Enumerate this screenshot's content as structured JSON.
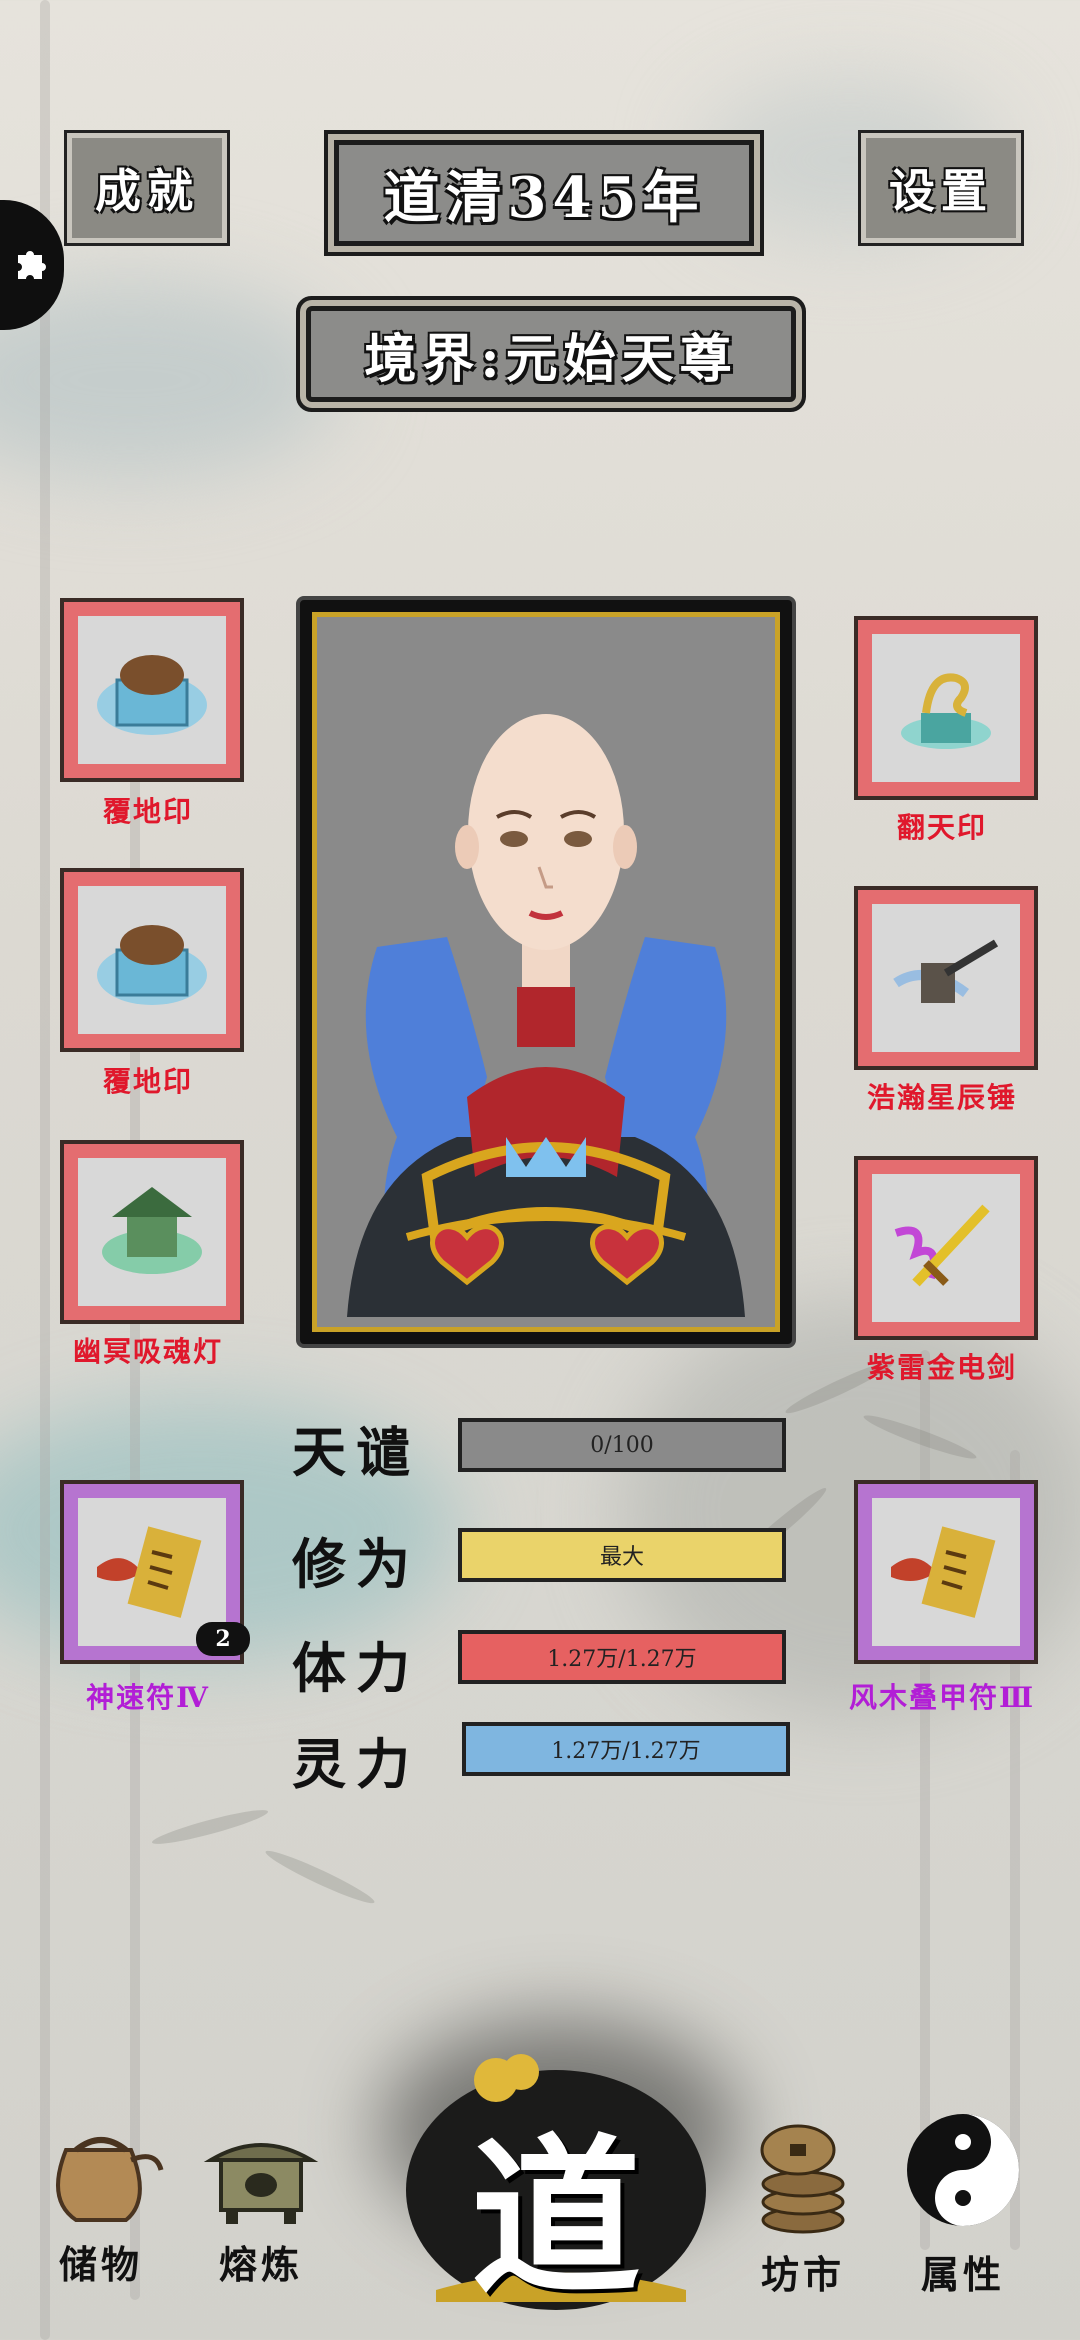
{
  "header": {
    "achievements_label": "成就",
    "year_title": "道清345年",
    "settings_label": "设置",
    "realm": "境界:元始天尊"
  },
  "left_items": [
    {
      "label": "覆地印",
      "rarity_color": "#e46d70"
    },
    {
      "label": "覆地印",
      "rarity_color": "#e46d70"
    },
    {
      "label": "幽冥吸魂灯",
      "rarity_color": "#e46d70"
    },
    {
      "label": "神速符Ⅳ",
      "rarity_color": "#b674d0",
      "count": "2"
    }
  ],
  "right_items": [
    {
      "label": "翻天印",
      "rarity_color": "#e46d70"
    },
    {
      "label": "浩瀚星辰锤",
      "rarity_color": "#e46d70"
    },
    {
      "label": "紫雷金电剑",
      "rarity_color": "#e46d70"
    },
    {
      "label": "风木叠甲符Ⅲ",
      "rarity_color": "#b674d0"
    }
  ],
  "stats": [
    {
      "label": "天谴",
      "value": "0/100",
      "color": "#8a8a8a",
      "fill": 0.0
    },
    {
      "label": "修为",
      "value": "最大",
      "color": "#ead36a",
      "fill": 1.0
    },
    {
      "label": "体力",
      "value": "1.27万/1.27万",
      "color": "#e66161",
      "fill": 1.0
    },
    {
      "label": "灵力",
      "value": "1.27万/1.27万",
      "color": "#7fb6e0",
      "fill": 1.0
    }
  ],
  "nav": {
    "storage": "储物",
    "smelt": "熔炼",
    "dao": "道",
    "market": "坊市",
    "attributes": "属性"
  }
}
